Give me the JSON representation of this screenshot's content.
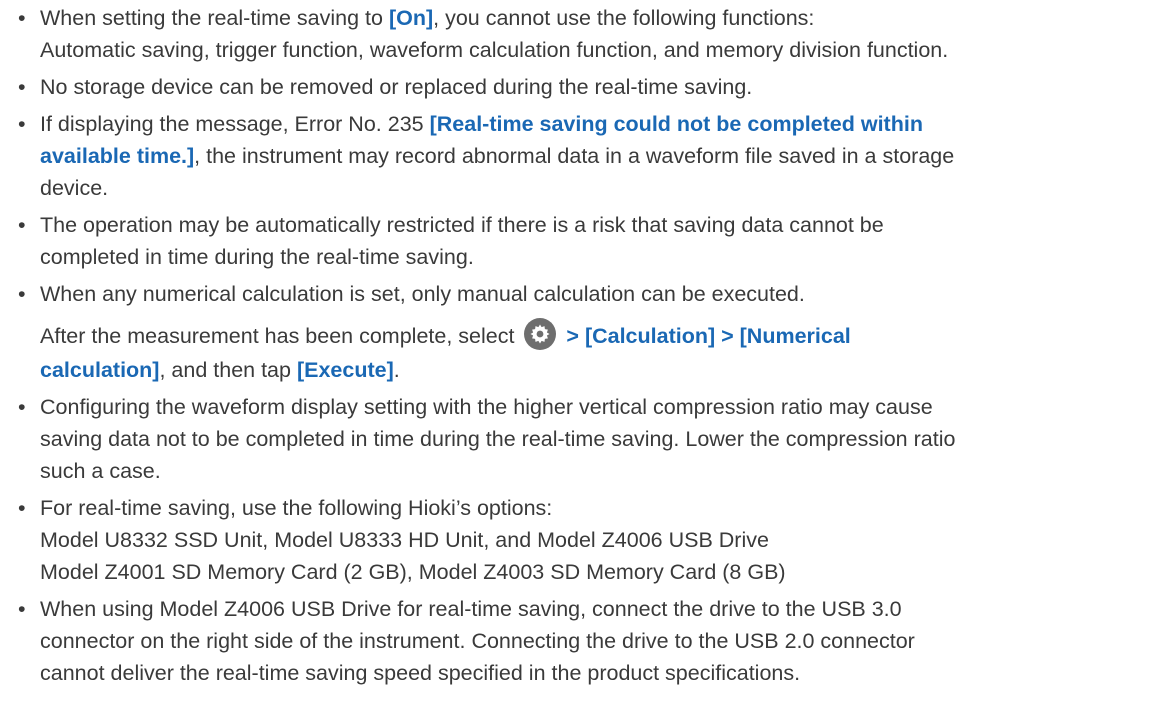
{
  "notes": [
    {
      "pre": "When setting the real-time saving to ",
      "kw": "[On]",
      "post": ", you cannot use the following functions:",
      "line2": "Automatic saving, trigger function, waveform calculation function, and memory division function."
    },
    {
      "text": "No storage device can be removed or replaced during the real-time saving."
    },
    {
      "pre": "If displaying the message, Error No. 235 ",
      "kw1": "[Real-time saving could not be completed within",
      "kw2": "available time.]",
      "post": ", the instrument may record abnormal data in a waveform file saved in a storage",
      "line3": "device."
    },
    {
      "line1": "The operation may be automatically restricted if there is a risk that saving data cannot be",
      "line2": "completed in time during the real-time saving."
    },
    {
      "line1": "When any numerical calculation is set, only manual calculation can be executed.",
      "pre": "After the measurement has been complete, select ",
      "icon": "gear-icon",
      "kw1": " > [Calculation] > [Numerical",
      "kw2": "calculation]",
      "mid": ", and then tap ",
      "kw3": "[Execute]",
      "post": "."
    },
    {
      "line1": "Configuring the waveform display setting with the higher vertical compression ratio may cause",
      "line2": "saving data not to be completed in time during the real-time saving. Lower the compression ratio",
      "line3": "such a case."
    },
    {
      "line1": "For real-time saving, use the following Hioki’s options:",
      "line2": "Model U8332 SSD Unit, Model U8333 HD Unit, and Model Z4006 USB Drive",
      "line3": "Model Z4001 SD Memory Card (2 GB), Model Z4003 SD Memory Card (8 GB)"
    },
    {
      "line1": "When using Model Z4006 USB Drive for real-time saving, connect the drive to the USB 3.0",
      "line2": "connector on the right side of the instrument. Connecting the drive to the USB 2.0 connector",
      "line3": "cannot deliver the real-time saving speed specified in the product specifications."
    }
  ],
  "bullet": "•",
  "colors": {
    "keyword": "#1a68b4",
    "text": "#3a3a3a",
    "icon_bg": "#6e6e6e"
  }
}
